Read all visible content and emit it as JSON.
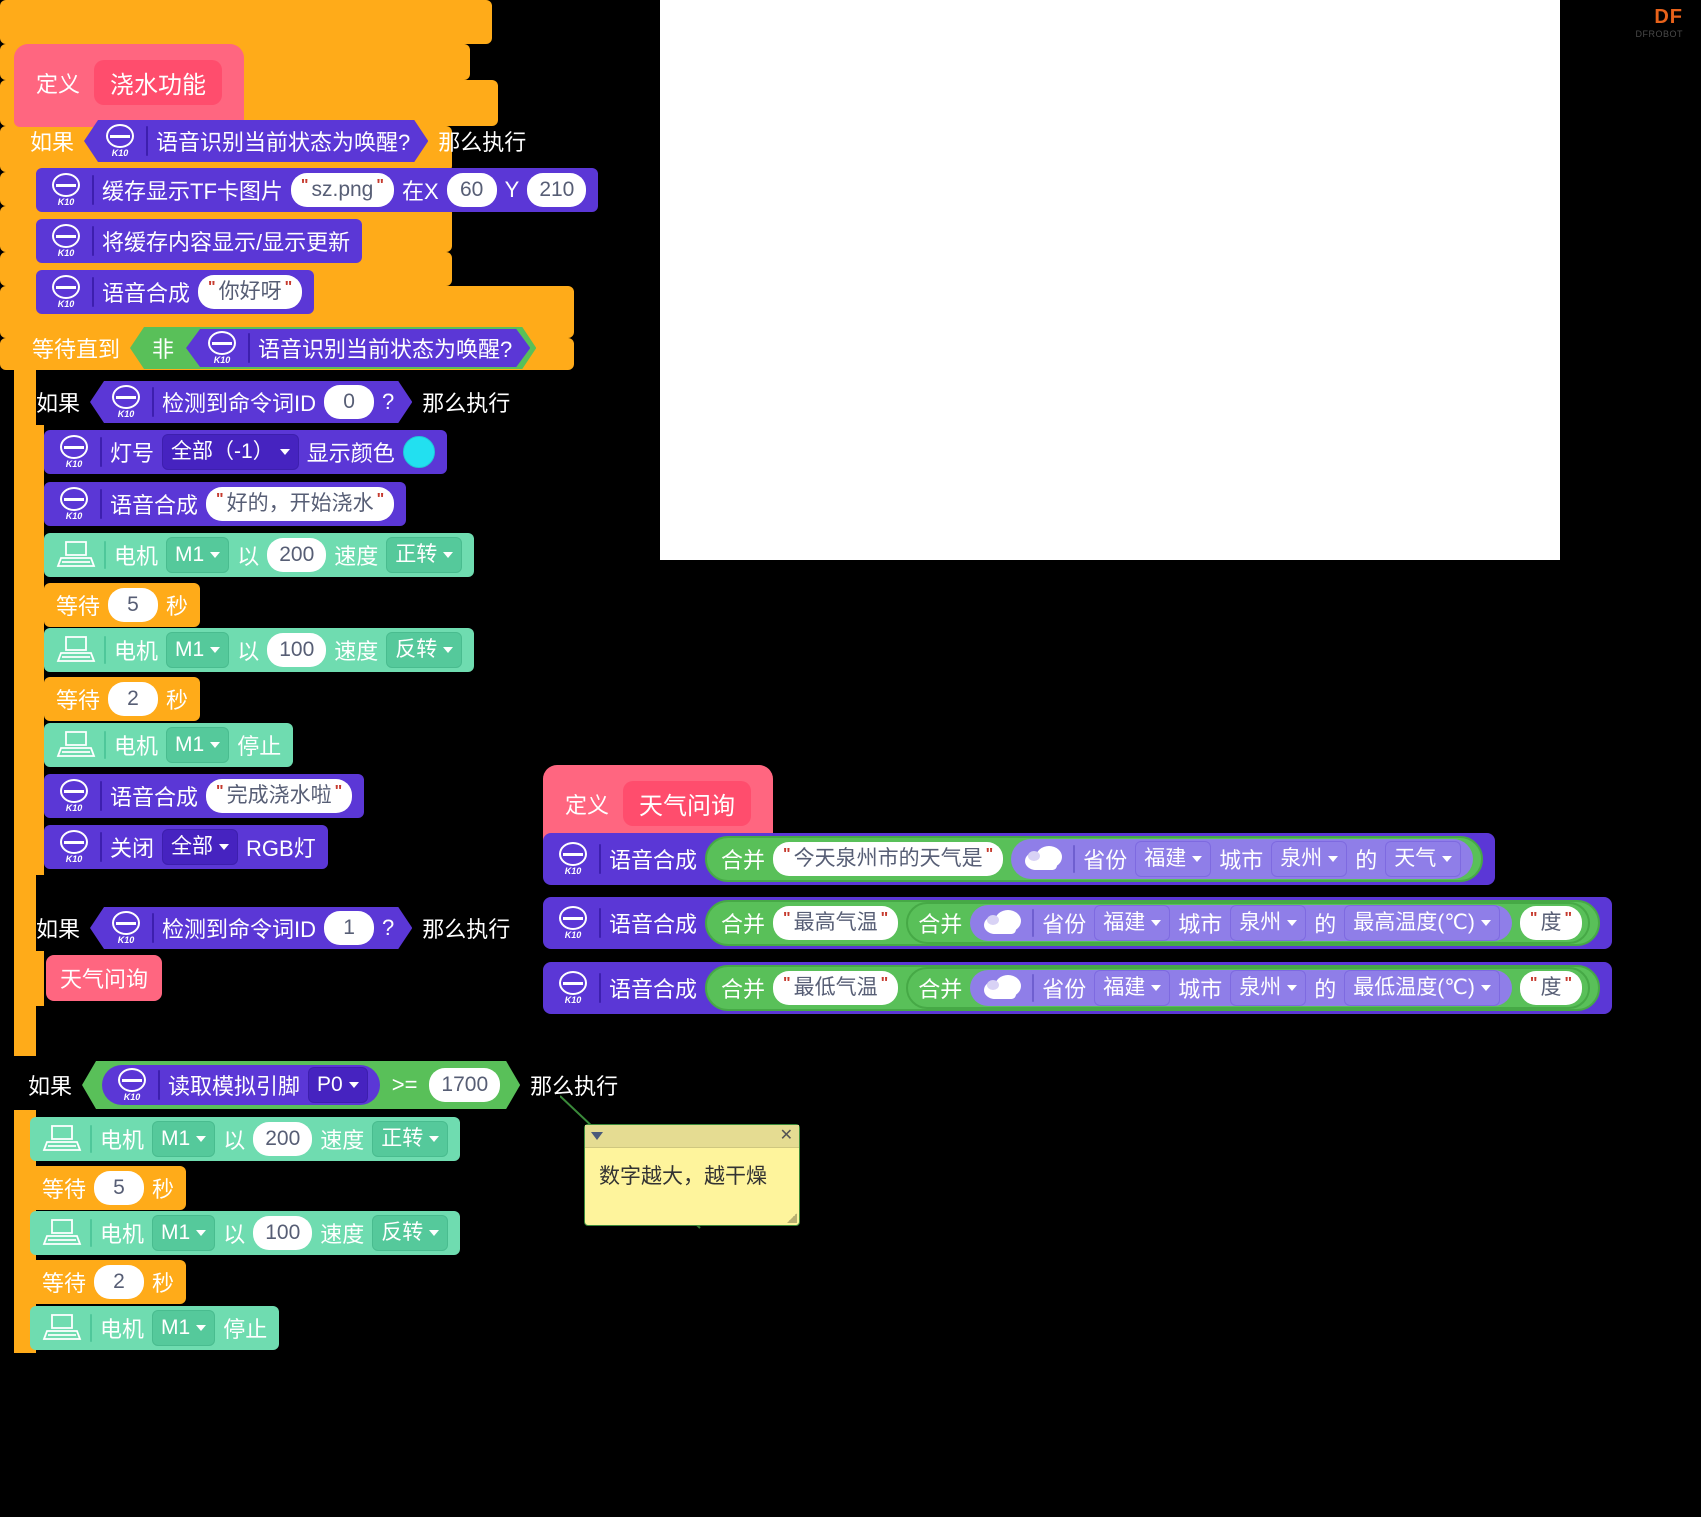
{
  "app": {
    "brand": "DF",
    "brand_sub": "DFROBOT"
  },
  "comment": {
    "text": "数字越大，越干燥",
    "collapse_icon": "chevron-down-icon",
    "close_icon": "close-icon"
  },
  "scripts": [
    {
      "id": "watering-function",
      "define_label": "定义",
      "procedure_name": "浇水功能",
      "blocks": [
        {
          "type": "if",
          "if_label": "如果",
          "then_label": "那么执行",
          "condition": {
            "kind": "k10-boolean",
            "text": "语音识别当前状态为唤醒?"
          }
        },
        {
          "type": "k10",
          "text": "缓存显示TF卡图片",
          "string": "sz.png",
          "mid": "在X",
          "num1": "60",
          "mid2": "Y",
          "num2": "210"
        },
        {
          "type": "k10",
          "text": "将缓存内容显示/显示更新"
        },
        {
          "type": "k10",
          "text": "语音合成",
          "string": "你好呀"
        },
        {
          "type": "wait-until",
          "label": "等待直到",
          "not_label": "非",
          "condition": {
            "kind": "k10-boolean",
            "text": "语音识别当前状态为唤醒?"
          }
        },
        {
          "type": "if",
          "if_label": "如果",
          "then_label": "那么执行",
          "condition": {
            "kind": "k10-boolean",
            "text": "检测到命令词ID",
            "value": "0",
            "suffix": "?"
          }
        },
        {
          "type": "k10-rgb",
          "prefix": "灯号",
          "dropdown": "全部（-1）",
          "mid": "显示颜色",
          "color": "#22e0f0"
        },
        {
          "type": "k10",
          "text": "语音合成",
          "string": "好的，开始浇水"
        },
        {
          "type": "motor",
          "prefix": "电机",
          "port": "M1",
          "mid": "以",
          "speed": "200",
          "mid2": "速度",
          "dir": "正转"
        },
        {
          "type": "wait",
          "label": "等待",
          "value": "5",
          "unit": "秒"
        },
        {
          "type": "motor",
          "prefix": "电机",
          "port": "M1",
          "mid": "以",
          "speed": "100",
          "mid2": "速度",
          "dir": "反转"
        },
        {
          "type": "wait",
          "label": "等待",
          "value": "2",
          "unit": "秒"
        },
        {
          "type": "motor-stop",
          "prefix": "电机",
          "port": "M1",
          "action": "停止"
        },
        {
          "type": "k10",
          "text": "语音合成",
          "string": "完成浇水啦"
        },
        {
          "type": "k10-rgboff",
          "prefix": "关闭",
          "dropdown": "全部",
          "suffix": "RGB灯"
        },
        {
          "type": "if",
          "if_label": "如果",
          "then_label": "那么执行",
          "condition": {
            "kind": "k10-boolean",
            "text": "检测到命令词ID",
            "value": "1",
            "suffix": "?"
          }
        },
        {
          "type": "call",
          "label": "天气问询"
        }
      ]
    },
    {
      "id": "weather-query",
      "define_label": "定义",
      "procedure_name": "天气问询",
      "rows": [
        {
          "speak_label": "语音合成",
          "join_label": "合并",
          "string": "今天泉州市的天气是",
          "weather": {
            "province_label": "省份",
            "province": "福建",
            "city_label": "城市",
            "city": "泉州",
            "of_label": "的",
            "field": "天气"
          }
        },
        {
          "speak_label": "语音合成",
          "join_label": "合并",
          "string": "最高气温",
          "join2_label": "合并",
          "weather": {
            "province_label": "省份",
            "province": "福建",
            "city_label": "城市",
            "city": "泉州",
            "of_label": "的",
            "field": "最高温度(℃)"
          },
          "tail_string": "度"
        },
        {
          "speak_label": "语音合成",
          "join_label": "合并",
          "string": "最低气温",
          "join2_label": "合并",
          "weather": {
            "province_label": "省份",
            "province": "福建",
            "city_label": "城市",
            "city": "泉州",
            "of_label": "的",
            "field": "最低温度(℃)"
          },
          "tail_string": "度"
        }
      ]
    },
    {
      "id": "moisture-check",
      "blocks": [
        {
          "type": "if",
          "if_label": "如果",
          "then_label": "那么执行",
          "condition": {
            "kind": "compare",
            "operator": ">=",
            "right": "1700",
            "left": {
              "kind": "k10-reporter",
              "text": "读取模拟引脚",
              "pin": "P0"
            }
          }
        },
        {
          "type": "motor",
          "prefix": "电机",
          "port": "M1",
          "mid": "以",
          "speed": "200",
          "mid2": "速度",
          "dir": "正转"
        },
        {
          "type": "wait",
          "label": "等待",
          "value": "5",
          "unit": "秒"
        },
        {
          "type": "motor",
          "prefix": "电机",
          "port": "M1",
          "mid": "以",
          "speed": "100",
          "mid2": "速度",
          "dir": "反转"
        },
        {
          "type": "wait",
          "label": "等待",
          "value": "2",
          "unit": "秒"
        },
        {
          "type": "motor-stop",
          "prefix": "电机",
          "port": "M1",
          "action": "停止"
        }
      ]
    }
  ],
  "colors": {
    "control": "#ffab19",
    "k10": "#5b37d6",
    "motor": "#6fdcb0",
    "operator": "#59c059",
    "procedure": "#ff6680",
    "cloud": "#8f7ee8",
    "rgb_value": "#22e0f0",
    "comment": "#fef49c"
  }
}
